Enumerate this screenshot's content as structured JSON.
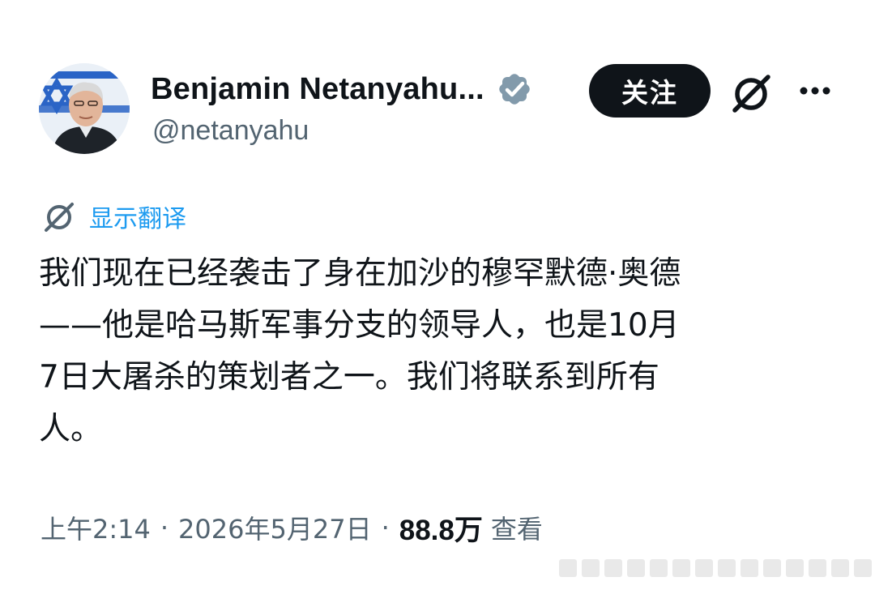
{
  "user": {
    "display_name": "Benjamin Netanyahu...",
    "handle": "@netanyahu",
    "verified_icon": "verified-badge-icon",
    "verified_color": "#829aab"
  },
  "actions": {
    "follow_label": "关注",
    "grok_icon": "grok-icon",
    "more_icon": "more-icon"
  },
  "translate": {
    "icon": "grok-icon",
    "label": "显示翻译",
    "color": "#1d9bf0"
  },
  "tweet": {
    "lines": [
      "我们现在已经袭击了身在加沙的穆罕默德·奥德",
      "——他是哈马斯军事分支的领导人，也是10月",
      "7日大屠杀的策划者之一。我们将联系到所有",
      "人。"
    ]
  },
  "meta": {
    "time": "上午2:14",
    "separator": "·",
    "date": "2026年5月27日",
    "views_count": "88.8万",
    "views_label": "查看"
  }
}
